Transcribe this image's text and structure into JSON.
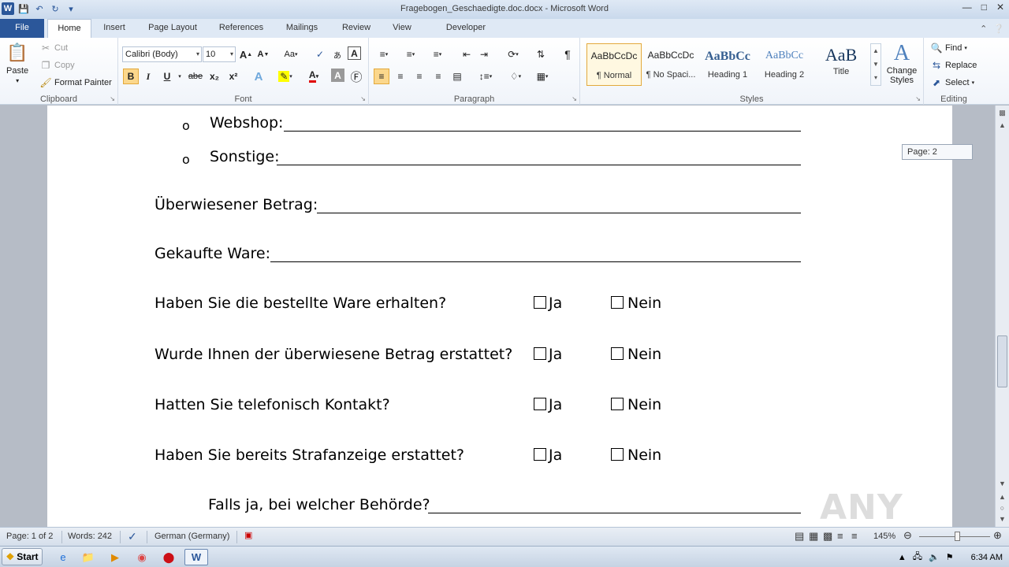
{
  "window": {
    "title": "Fragebogen_Geschaedigte.doc.docx  -  Microsoft Word",
    "app_icon_letter": "W"
  },
  "tabs": [
    "File",
    "Home",
    "Insert",
    "Page Layout",
    "References",
    "Mailings",
    "Review",
    "View",
    "Developer"
  ],
  "ribbon": {
    "clipboard": {
      "label": "Clipboard",
      "paste": "Paste",
      "cut": "Cut",
      "copy": "Copy",
      "format_painter": "Format Painter"
    },
    "font": {
      "label": "Font",
      "font_name": "Calibri (Body)",
      "font_size": "10",
      "bold": "B",
      "italic": "I",
      "underline": "U",
      "strike": "abe",
      "subscript": "x₂",
      "superscript": "x²",
      "grow": "A",
      "shrink": "A",
      "change_case": "Aa",
      "text_effects": "A",
      "font_color": "A",
      "char_shading": "A"
    },
    "paragraph": {
      "label": "Paragraph",
      "pilcrow": "¶"
    },
    "styles": {
      "label": "Styles",
      "items": [
        {
          "preview": "AaBbCcDc",
          "name": "¶ Normal"
        },
        {
          "preview": "AaBbCcDc",
          "name": "¶ No Spaci..."
        },
        {
          "preview": "AaBbCc",
          "name": "Heading 1"
        },
        {
          "preview": "AaBbCc",
          "name": "Heading 2"
        },
        {
          "preview": "AaB",
          "name": "Title"
        }
      ],
      "change_styles": "Change Styles"
    },
    "editing": {
      "label": "Editing",
      "find": "Find",
      "replace": "Replace",
      "select": "Select"
    }
  },
  "document": {
    "bullet_lines": [
      {
        "label": "Webshop:"
      },
      {
        "label": "Sonstige:"
      }
    ],
    "fields": [
      {
        "label": "Überwiesener  Betrag:"
      },
      {
        "label": "Gekaufte Ware:"
      }
    ],
    "questions": [
      {
        "text": "Haben Sie die bestellte Ware erhalten?",
        "yes": "Ja",
        "no": "Nein"
      },
      {
        "text": "Wurde Ihnen der überwiesene Betrag erstattet?",
        "yes": "Ja",
        "no": "Nein"
      },
      {
        "text": "Hatten Sie telefonisch Kontakt?",
        "yes": "Ja",
        "no": "Nein"
      },
      {
        "text": "Haben Sie bereits Strafanzeige erstattet?",
        "yes": "Ja",
        "no": "Nein"
      }
    ],
    "followup": "Falls ja, bei welcher Behörde?",
    "page_tooltip": "Page: 2",
    "watermark": "ANY RUN"
  },
  "statusbar": {
    "page": "Page: 1 of 2",
    "words": "Words: 242",
    "language": "German (Germany)",
    "zoom": "145%"
  },
  "taskbar": {
    "start": "Start",
    "clock": "6:34 AM"
  }
}
